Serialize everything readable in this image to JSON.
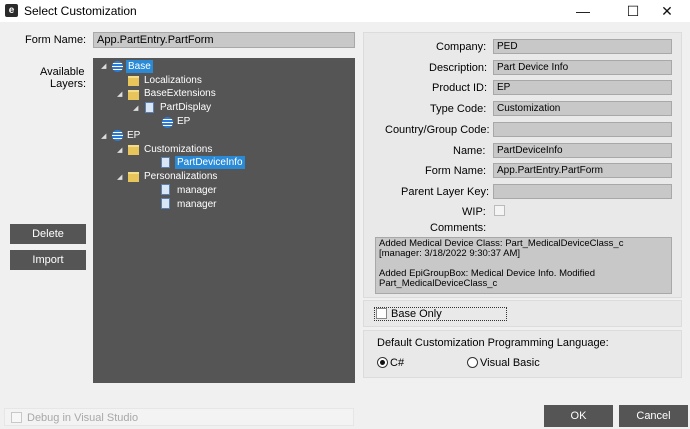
{
  "window": {
    "title": "Select Customization",
    "app_icon_letter": "e",
    "minimize_glyph": "—",
    "maximize_glyph": "☐",
    "close_glyph": "✕"
  },
  "form_name": {
    "label": "Form Name:",
    "value": "App.PartEntry.PartForm"
  },
  "available_layers_label_1": "Available",
  "available_layers_label_2": "Layers:",
  "tree": [
    {
      "label": "Base",
      "icon": "layer-icon",
      "selected": true
    },
    {
      "label": "Localizations",
      "icon": "folder-icon"
    },
    {
      "label": "BaseExtensions",
      "icon": "folder-icon"
    },
    {
      "label": "PartDisplay",
      "icon": "document-icon"
    },
    {
      "label": "EP",
      "icon": "layer-icon"
    },
    {
      "label": "EP",
      "icon": "layer-icon"
    },
    {
      "label": "Customizations",
      "icon": "folder-icon"
    },
    {
      "label": "PartDeviceInfo",
      "icon": "document-icon",
      "selected": true
    },
    {
      "label": "Personalizations",
      "icon": "folder-icon"
    },
    {
      "label": "manager",
      "icon": "document-icon"
    },
    {
      "label": "manager",
      "icon": "document-icon"
    }
  ],
  "buttons": {
    "delete": "Delete",
    "import": "Import",
    "ok": "OK",
    "cancel": "Cancel"
  },
  "details": {
    "company": {
      "label": "Company:",
      "value": "PED"
    },
    "description": {
      "label": "Description:",
      "value": "Part Device Info"
    },
    "product_id": {
      "label": "Product ID:",
      "value": "EP"
    },
    "type_code": {
      "label": "Type Code:",
      "value": "Customization"
    },
    "country_group_code": {
      "label": "Country/Group Code:",
      "value": ""
    },
    "name": {
      "label": "Name:",
      "value": "PartDeviceInfo"
    },
    "form_name": {
      "label": "Form Name:",
      "value": "App.PartEntry.PartForm"
    },
    "parent_layer_key": {
      "label": "Parent Layer Key:",
      "value": ""
    },
    "wip": {
      "label": "WIP:",
      "checked": false
    },
    "comments_label": "Comments:",
    "comments": [
      "Added Medical Device Class: Part_MedicalDeviceClass_c",
      "[manager: 3/18/2022 9:30:37 AM]",
      "",
      "Added EpiGroupBox: Medical Device Info. Modified",
      "Part_MedicalDeviceClass_c"
    ]
  },
  "base_only": {
    "label": "Base Only",
    "checked": false
  },
  "language": {
    "label": "Default Customization Programming Language:",
    "options": [
      "C#",
      "Visual Basic"
    ],
    "selected": "C#"
  },
  "debug": {
    "label": "Debug in Visual Studio",
    "checked": false,
    "enabled": false
  }
}
